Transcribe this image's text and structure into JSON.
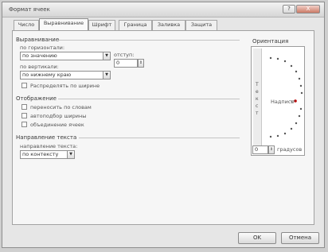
{
  "window": {
    "title": "Формат ячеек",
    "help_label": "?",
    "close_label": "X"
  },
  "tabs": [
    {
      "label": "Число"
    },
    {
      "label": "Выравнивание"
    },
    {
      "label": "Шрифт"
    },
    {
      "label": "Граница"
    },
    {
      "label": "Заливка"
    },
    {
      "label": "Защита"
    }
  ],
  "alignment": {
    "section_label": "Выравнивание",
    "horizontal_label": "по горизонтали:",
    "horizontal_value": "по значению",
    "indent_label": "отступ:",
    "indent_value": "0",
    "vertical_label": "по вертикали:",
    "vertical_value": "по нижнему краю",
    "distributed_label": "Распределять по ширине"
  },
  "display": {
    "section_label": "Отображение",
    "wrap_label": "переносить по словам",
    "shrink_label": "автоподбор ширины",
    "merge_label": "объединение ячеек"
  },
  "direction": {
    "section_label": "Направление текста",
    "label": "направление текста:",
    "value": "по контексту"
  },
  "orientation": {
    "section_label": "Ориентация",
    "vertical_text": [
      "Т",
      "е",
      "к",
      "с",
      "т"
    ],
    "sample_label": "Надпись",
    "degrees_value": "0",
    "degrees_label": "градусов"
  },
  "buttons": {
    "ok": "OK",
    "cancel": "Отмена"
  }
}
